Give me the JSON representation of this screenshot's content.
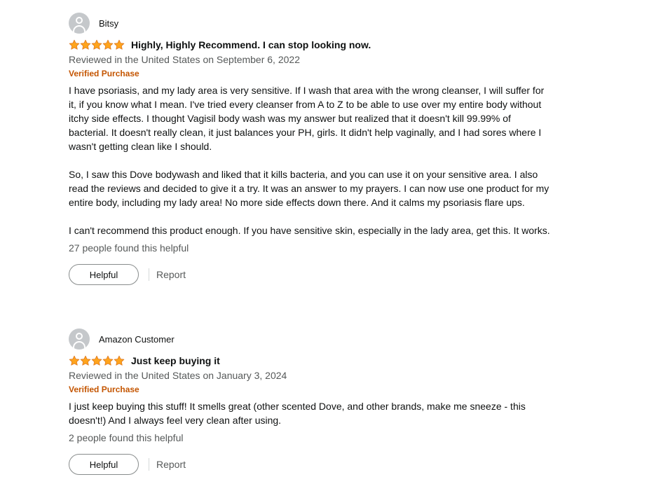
{
  "colors": {
    "star": "#ffa41c",
    "verified": "#c45500",
    "muted": "#565959"
  },
  "reviews": [
    {
      "profile_name": "Bitsy",
      "rating": 5,
      "title": "Highly, Highly Recommend. I can stop looking now.",
      "date": "Reviewed in the United States on September 6, 2022",
      "verified": "Verified Purchase",
      "paragraphs": [
        "I have psoriasis, and my lady area is very sensitive. If I wash that area with the wrong cleanser, I will suffer for it, if you know what I mean. I've tried every cleanser from A to Z to be able to use over my entire body without itchy side effects. I thought Vagisil body wash was my answer but realized that it doesn't kill 99.99% of bacterial. It doesn't really clean, it just balances your PH, girls. It didn't help vaginally, and I had sores where I wasn't getting clean like I should.",
        "So, I saw this Dove bodywash and liked that it kills bacteria, and you can use it on your sensitive area. I also read the reviews and decided to give it a try. It was an answer to my prayers. I can now use one product for my entire body, including my lady area! No more side effects down there. And it calms my psoriasis flare ups.",
        "I can't recommend this product enough. If you have sensitive skin, especially in the lady area, get this. It works."
      ],
      "helpful_count": "27 people found this helpful",
      "helpful_label": "Helpful",
      "report_label": "Report"
    },
    {
      "profile_name": "Amazon Customer",
      "rating": 5,
      "title": "Just keep buying it",
      "date": "Reviewed in the United States on January 3, 2024",
      "verified": "Verified Purchase",
      "paragraphs": [
        "I just keep buying this stuff! It smells great (other scented Dove, and other brands, make me sneeze - this doesn't!) And I always feel very clean after using."
      ],
      "helpful_count": "2 people found this helpful",
      "helpful_label": "Helpful",
      "report_label": "Report"
    }
  ]
}
